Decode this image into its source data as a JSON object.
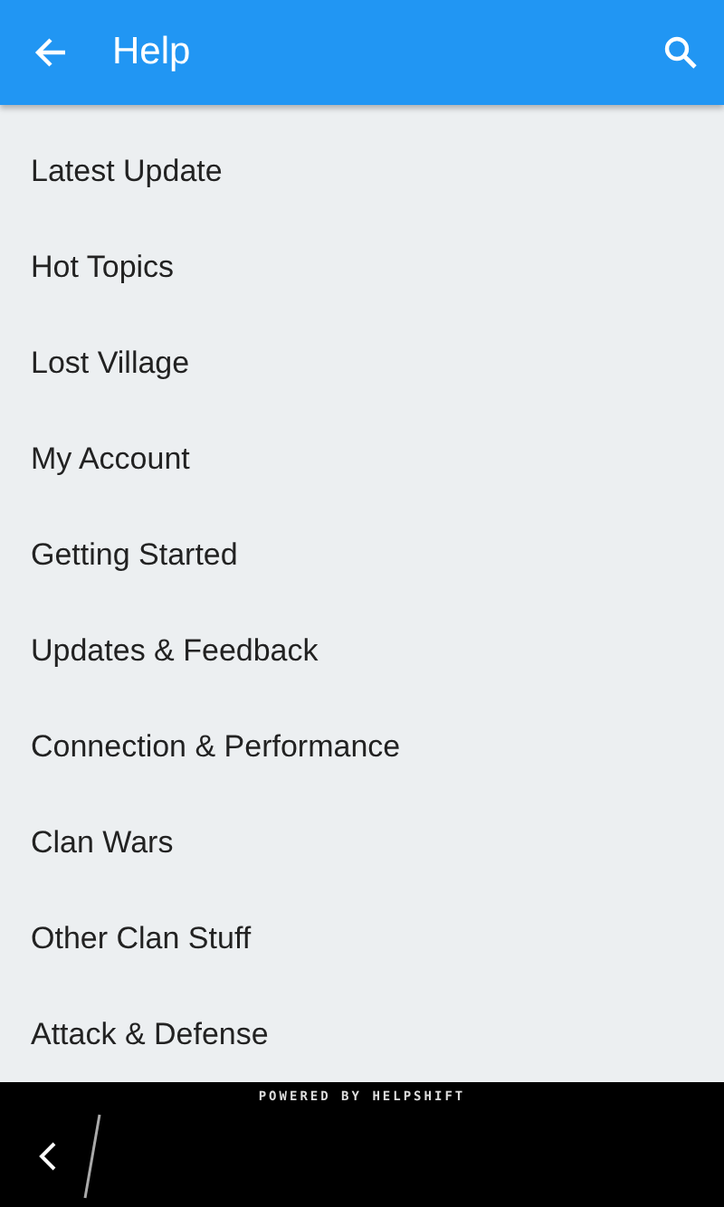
{
  "app_bar": {
    "title": "Help"
  },
  "topics": [
    {
      "label": "Latest Update"
    },
    {
      "label": "Hot Topics"
    },
    {
      "label": "Lost Village"
    },
    {
      "label": "My Account"
    },
    {
      "label": "Getting Started"
    },
    {
      "label": "Updates & Feedback"
    },
    {
      "label": "Connection & Performance"
    },
    {
      "label": "Clan Wars"
    },
    {
      "label": "Other Clan Stuff"
    },
    {
      "label": "Attack & Defense"
    }
  ],
  "footer": {
    "branding": "POWERED BY HELPSHIFT"
  }
}
